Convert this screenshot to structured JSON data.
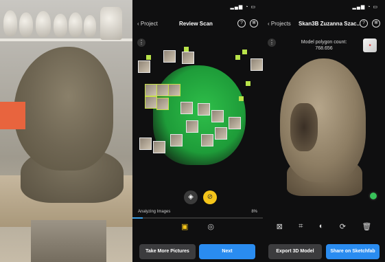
{
  "scan_screen": {
    "back_label": "Project",
    "title": "Review Scan",
    "progress_label": "Analyzing Images",
    "progress_pct": "8%",
    "progress_value": 0.08,
    "take_more_label": "Take More Pictures",
    "next_label": "Next"
  },
  "model_screen": {
    "back_label": "Projects",
    "title": "Skan3B Zuzanna Szac...",
    "poly_label": "Model polygon count:",
    "poly_count": "768.656",
    "export_label": "Export 3D Model",
    "share_label": "Share on Sketchfab"
  },
  "colors": {
    "accent_yellow": "#f5c51a",
    "accent_blue": "#2a8cf0",
    "scan_green": "#2fbf4a",
    "orange_mark": "#e8643e"
  },
  "icons": [
    "help-icon",
    "settings-icon",
    "more-icon",
    "paint-bucket-icon",
    "target-icon",
    "image-icon",
    "layers-icon",
    "crop-icon",
    "rotate-icon",
    "refresh-icon",
    "trash-icon",
    "orientation-cube-icon"
  ]
}
